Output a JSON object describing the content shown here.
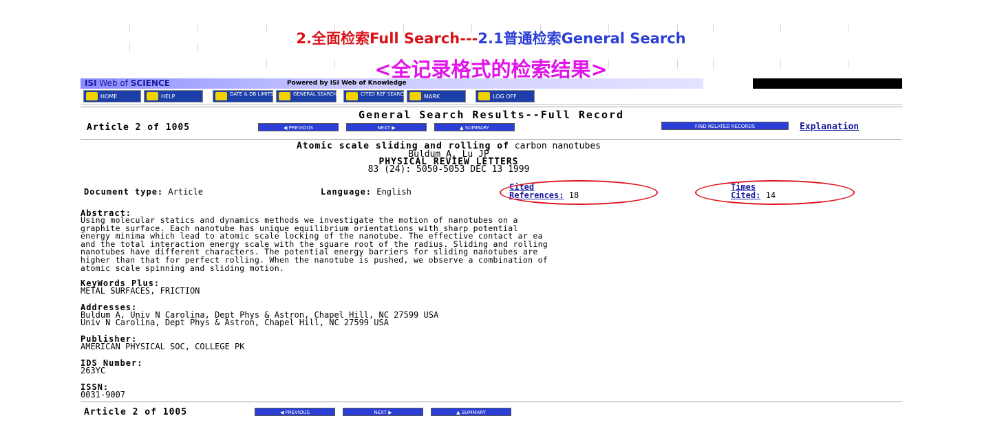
{
  "slide": {
    "title_prefix": "2.全面检索Full Search---",
    "title_suffix": "2.1普通检索General Search",
    "subtitle": "<全记录格式的检索结果>"
  },
  "banner": {
    "logo_isi": "ISI",
    "logo_wos": "Web of",
    "logo_science": "SCIENCE",
    "powered": "Powered by ISI Web of Knowledge"
  },
  "toolbar": {
    "home": "HOME",
    "help": "HELP",
    "date": "DATE & DB LIMITS",
    "general_search": "GENERAL SEARCH",
    "cited_ref": "CITED REF SEARCH",
    "mark": "MARK",
    "logoff": "LOG OFF"
  },
  "results": {
    "heading": "General Search Results--Full Record",
    "article_counter": "Article 2 of 1005",
    "previous": "◀ PREVIOUS",
    "next": "NEXT ▶",
    "summary": "▲ SUMMARY",
    "find_related": "FIND RELATED RECORDS",
    "explanation": "Explanation"
  },
  "record": {
    "title_bold": "Atomic scale sliding and rolling of",
    "title_rest": " carbon nanotubes",
    "authors": "Buldum A, Lu JP",
    "journal": "PHYSICAL REVIEW LETTERS",
    "citation": "83 (24): 5050-5053 DEC 13 1999",
    "doc_type_label": "Document type:",
    "doc_type": "Article",
    "language_label": "Language:",
    "language": "English",
    "cited_refs_line1": "Cited",
    "cited_refs_line2": "References:",
    "cited_refs_count": "18",
    "times_cited_line1": "Times",
    "times_cited_line2": "Cited:",
    "times_cited_count": "14",
    "abstract_label": "Abstract:",
    "abstract": "Using molecular statics and dynamics methods we investigate the motion of nanotubes on a\ngraphite surface. Each nanotube has unique equilibrium orientations with sharp potential\nenergy minima which lead to atomic scale locking of the nanotube. The effective contact ar ea\nand the total interaction energy scale with the square root of the radius. Sliding and rolling\nnanotubes have different characters. The potential energy barriers for sliding nanotubes are\nhigher than that for perfect rolling. When the nanotube is pushed, we observe a combination of\natomic scale spinning and sliding motion.",
    "keywords_label": "KeyWords Plus:",
    "keywords": "METAL SURFACES, FRICTION",
    "addresses_label": "Addresses:",
    "address1": "Buldum A, Univ N Carolina, Dept Phys & Astron, Chapel Hill, NC 27599 USA",
    "address2": "Univ N Carolina, Dept Phys & Astron, Chapel Hill, NC 27599 USA",
    "publisher_label": "Publisher:",
    "publisher": "AMERICAN PHYSICAL SOC, COLLEGE PK",
    "ids_label": "IDS Number:",
    "ids": "263YC",
    "issn_label": "ISSN:",
    "issn": "0031-9007"
  },
  "colors": {
    "title_blue": "#2b3fd6",
    "title_red": "#d8141a",
    "subtitle_magenta": "#e014e8",
    "oval_red": "#e0141e",
    "button_blue": "#2b3fd6"
  }
}
